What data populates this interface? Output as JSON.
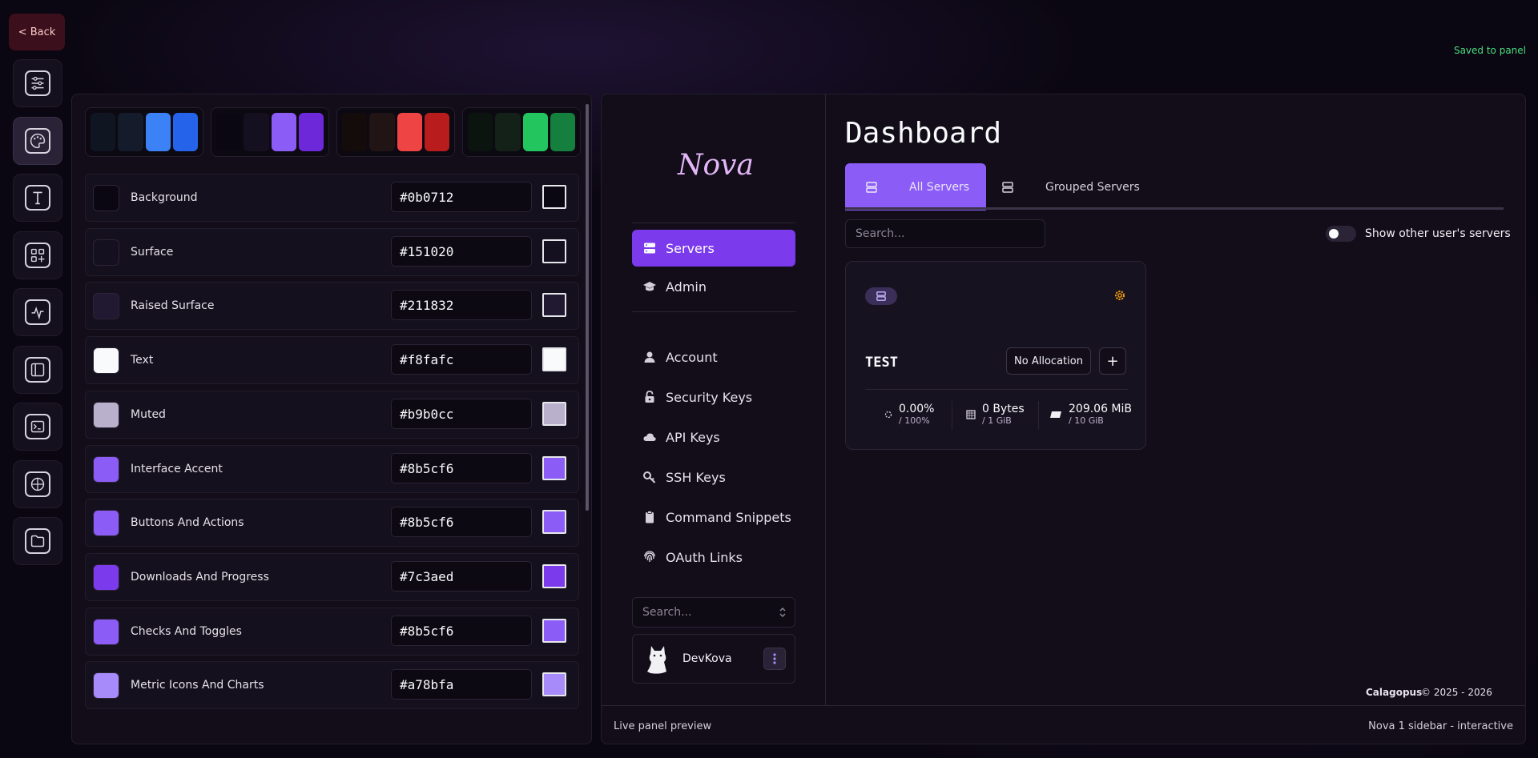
{
  "top": {
    "back_label": "< Back",
    "saved_text": "Saved to panel"
  },
  "rail": {
    "items": [
      {
        "name": "sliders-icon"
      },
      {
        "name": "palette-icon",
        "active": true
      },
      {
        "name": "typography-icon"
      },
      {
        "name": "widgets-icon"
      },
      {
        "name": "activity-icon"
      },
      {
        "name": "layout-sidebar-icon"
      },
      {
        "name": "terminal-icon"
      },
      {
        "name": "globe-icon"
      },
      {
        "name": "folder-icon"
      }
    ]
  },
  "palettes": [
    {
      "colors": [
        "#0f1521",
        "#141c2b",
        "#3b82f6",
        "#2563eb"
      ]
    },
    {
      "colors": [
        "#0b0712",
        "#151020",
        "#8b5cf6",
        "#6d28d9"
      ]
    },
    {
      "colors": [
        "#140b0b",
        "#211414",
        "#ef4444",
        "#b91c1c"
      ]
    },
    {
      "colors": [
        "#0b140e",
        "#142118",
        "#22c55e",
        "#15803d"
      ]
    }
  ],
  "colors": [
    {
      "label": "Background",
      "hex": "#0b0712"
    },
    {
      "label": "Surface",
      "hex": "#151020"
    },
    {
      "label": "Raised Surface",
      "hex": "#211832"
    },
    {
      "label": "Text",
      "hex": "#f8fafc"
    },
    {
      "label": "Muted",
      "hex": "#b9b0cc"
    },
    {
      "label": "Interface Accent",
      "hex": "#8b5cf6"
    },
    {
      "label": "Buttons And Actions",
      "hex": "#8b5cf6"
    },
    {
      "label": "Downloads And Progress",
      "hex": "#7c3aed"
    },
    {
      "label": "Checks And Toggles",
      "hex": "#8b5cf6"
    },
    {
      "label": "Metric Icons And Charts",
      "hex": "#a78bfa"
    }
  ],
  "preview": {
    "logo": "Nova",
    "nav_main": [
      {
        "label": "Servers",
        "icon": "server-icon",
        "active": true
      },
      {
        "label": "Admin",
        "icon": "graduation-cap-icon"
      }
    ],
    "nav_account": [
      {
        "label": "Account",
        "icon": "user-icon"
      },
      {
        "label": "Security Keys",
        "icon": "lock-icon"
      },
      {
        "label": "API Keys",
        "icon": "cloud-icon"
      },
      {
        "label": "SSH Keys",
        "icon": "key-icon"
      },
      {
        "label": "Command Snippets",
        "icon": "clipboard-icon"
      },
      {
        "label": "OAuth Links",
        "icon": "fingerprint-icon"
      }
    ],
    "sidebar_search_placeholder": "Search...",
    "user_name": "DevKova",
    "title": "Dashboard",
    "tabs": [
      {
        "label": "All Servers",
        "active": true
      },
      {
        "label": "Grouped Servers"
      }
    ],
    "search_placeholder": "Search...",
    "toggle_label": "Show other user's servers",
    "toggle_on": false,
    "server": {
      "name": "TEST",
      "allocation": "No Allocation",
      "add_label": "+",
      "cpu": {
        "value": "0.00%",
        "limit": "/ 100%"
      },
      "memory": {
        "value": "0 Bytes",
        "limit": "/ 1 GiB"
      },
      "disk": {
        "value": "209.06 MiB",
        "limit": "/ 10 GiB"
      }
    },
    "brand": "Calagopus",
    "copyright": "© 2025 - 2026",
    "footer_left": "Live panel preview",
    "footer_right": "Nova 1 sidebar - interactive"
  }
}
